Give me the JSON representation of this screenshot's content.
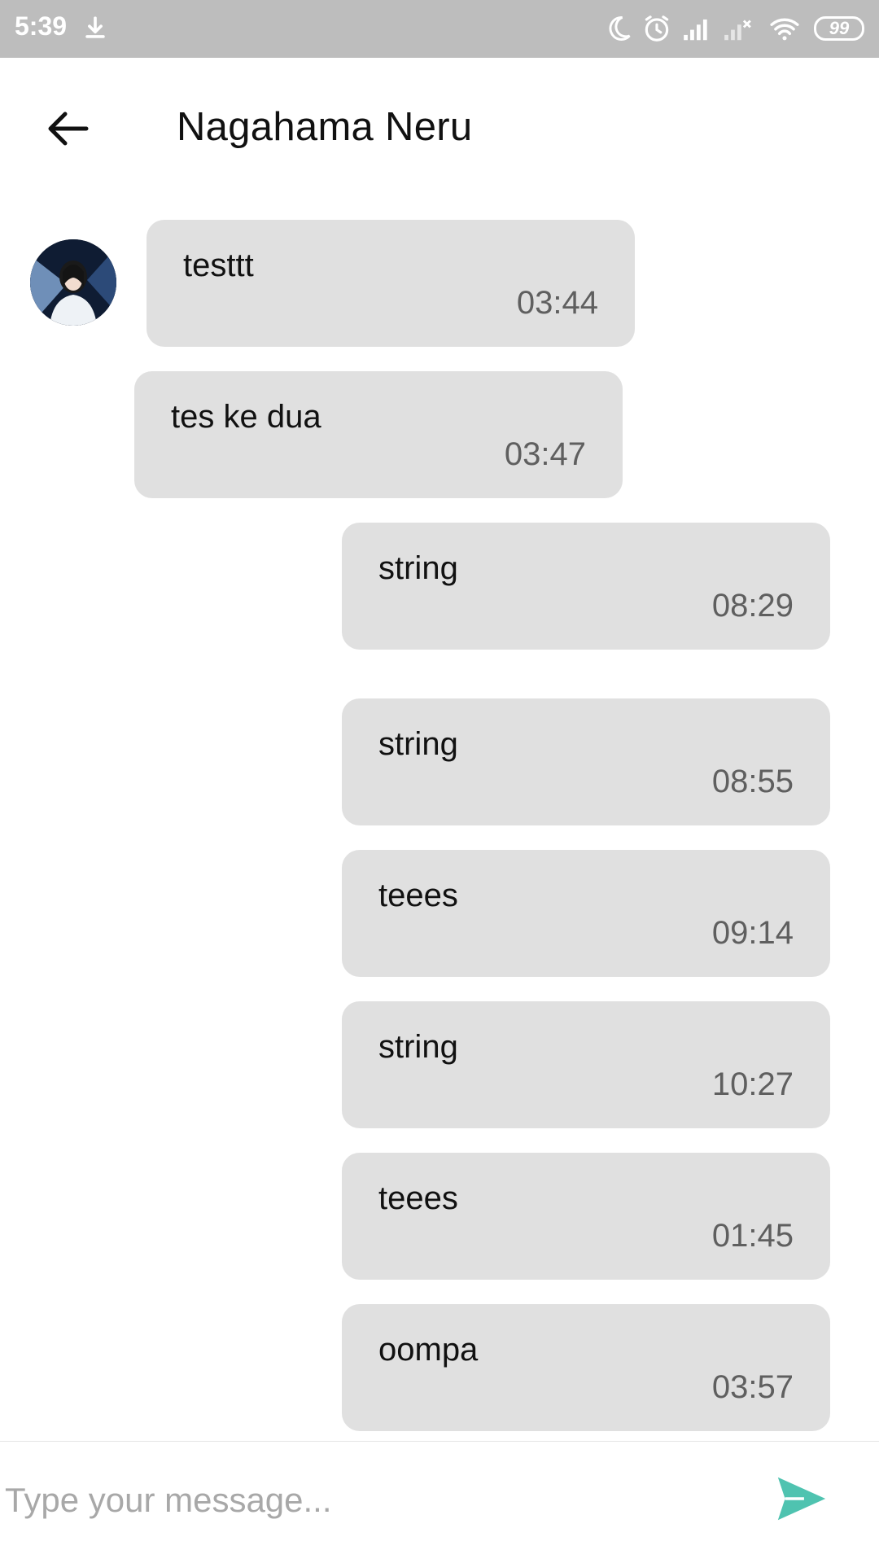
{
  "status_bar": {
    "time": "5:39",
    "battery": "99",
    "icons": [
      "download-icon",
      "moon-icon",
      "alarm-icon",
      "signal-icon",
      "signal-off-icon",
      "wifi-icon",
      "battery-icon"
    ]
  },
  "header": {
    "back_icon": "arrow-left-icon",
    "title": "Nagahama Neru"
  },
  "messages": [
    {
      "side": "left",
      "text": "testtt",
      "time": "03:44",
      "avatar": true
    },
    {
      "side": "left",
      "text": "tes ke dua",
      "time": "03:47",
      "avatar": false
    },
    {
      "side": "right",
      "text": "string",
      "time": "08:29"
    },
    {
      "side": "right",
      "text": "string",
      "time": "08:55"
    },
    {
      "side": "right",
      "text": "teees",
      "time": "09:14"
    },
    {
      "side": "right",
      "text": "string",
      "time": "10:27"
    },
    {
      "side": "right",
      "text": "teees",
      "time": "01:45"
    },
    {
      "side": "right",
      "text": "oompa",
      "time": "03:57"
    }
  ],
  "composer": {
    "placeholder": "Type your message...",
    "value": "",
    "send_icon": "send-icon"
  },
  "colors": {
    "status_bar": "#bdbdbd",
    "bubble": "#e0e0e0",
    "send_accent": "#4fc3b0",
    "time_text": "#5f5f5f"
  }
}
